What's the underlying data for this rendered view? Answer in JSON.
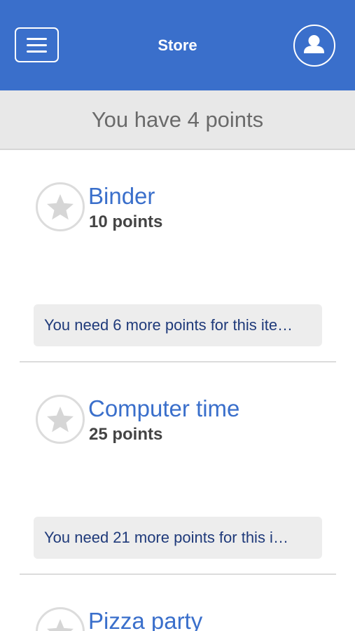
{
  "header": {
    "title": "Store",
    "menu_icon": "hamburger-menu-icon",
    "account_icon": "user-avatar-icon",
    "background_color": "#3a6fcb"
  },
  "points_summary": "You have 4 points",
  "items": [
    {
      "name": "Binder",
      "cost": "10 points",
      "need_message": "You need 6 more points for this ite…",
      "icon": "star-icon"
    },
    {
      "name": "Computer time",
      "cost": "25 points",
      "need_message": "You need 21 more points for this i…",
      "icon": "star-icon"
    },
    {
      "name": "Pizza party",
      "icon": "star-icon"
    }
  ]
}
